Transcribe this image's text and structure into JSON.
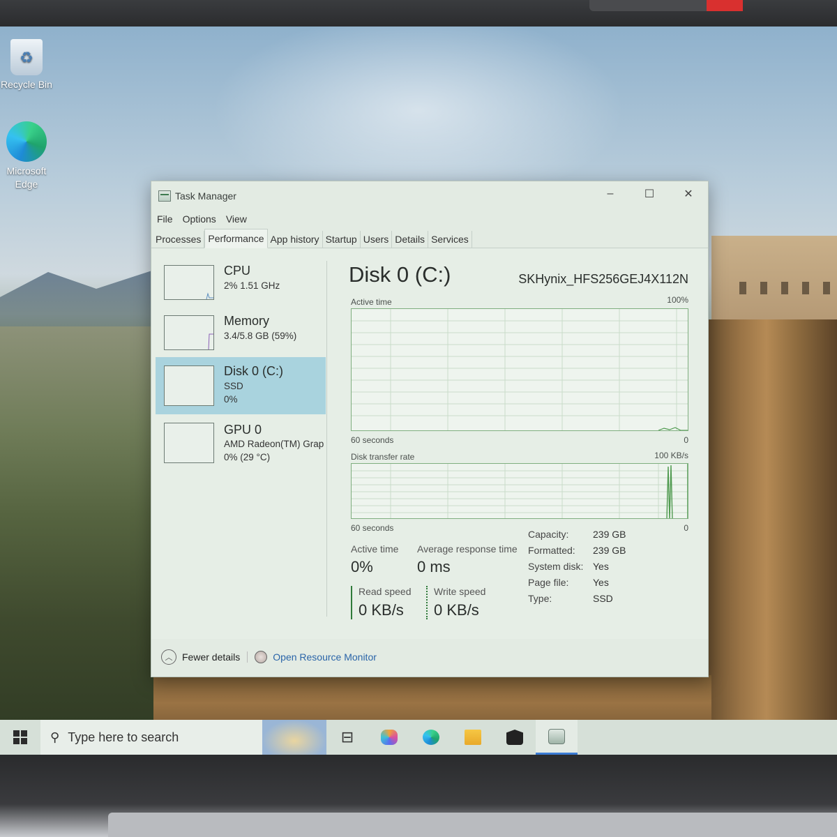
{
  "desktop": {
    "icons": [
      {
        "label": "Recycle Bin",
        "icon": "recycle-bin-icon"
      },
      {
        "label": "Microsoft Edge",
        "icon": "edge-icon"
      }
    ]
  },
  "window": {
    "title": "Task Manager",
    "controls": {
      "minimize": "–",
      "maximize": "☐",
      "close": "✕"
    },
    "menu": [
      "File",
      "Options",
      "View"
    ],
    "tabs": [
      "Processes",
      "Performance",
      "App history",
      "Startup",
      "Users",
      "Details",
      "Services"
    ],
    "active_tab": "Performance"
  },
  "resources": [
    {
      "title": "CPU",
      "sub1": "2%  1.51 GHz",
      "sub2": ""
    },
    {
      "title": "Memory",
      "sub1": "3.4/5.8 GB (59%)",
      "sub2": ""
    },
    {
      "title": "Disk 0 (C:)",
      "sub1": "SSD",
      "sub2": "0%"
    },
    {
      "title": "GPU 0",
      "sub1": "AMD Radeon(TM) Grap",
      "sub2": "0%  (29 °C)"
    }
  ],
  "detail": {
    "title": "Disk 0 (C:)",
    "model": "SKHynix_HFS256GEJ4X112N",
    "graph1": {
      "label": "Active time",
      "max": "100%",
      "time": "60 seconds",
      "min": "0"
    },
    "graph2": {
      "label": "Disk transfer rate",
      "max": "100 KB/s",
      "time": "60 seconds",
      "min": "0"
    },
    "stats": {
      "active_time_label": "Active time",
      "active_time_value": "0%",
      "avg_response_label": "Average response time",
      "avg_response_value": "0 ms",
      "read_speed_label": "Read speed",
      "read_speed_value": "0 KB/s",
      "write_speed_label": "Write speed",
      "write_speed_value": "0 KB/s"
    },
    "properties": [
      {
        "key": "Capacity:",
        "value": "239 GB"
      },
      {
        "key": "Formatted:",
        "value": "239 GB"
      },
      {
        "key": "System disk:",
        "value": "Yes"
      },
      {
        "key": "Page file:",
        "value": "Yes"
      },
      {
        "key": "Type:",
        "value": "SSD"
      }
    ]
  },
  "footer": {
    "fewer_details": "Fewer details",
    "resource_monitor": "Open Resource Monitor"
  },
  "taskbar": {
    "search_placeholder": "Type here to search",
    "pinned": [
      "task-view-icon",
      "copilot-icon",
      "edge-icon",
      "file-explorer-icon",
      "mail-icon",
      "task-manager-icon"
    ]
  },
  "colors": {
    "accent_selected": "#a9d3de",
    "graph_green": "#7fae7f",
    "link": "#2a64a8"
  }
}
